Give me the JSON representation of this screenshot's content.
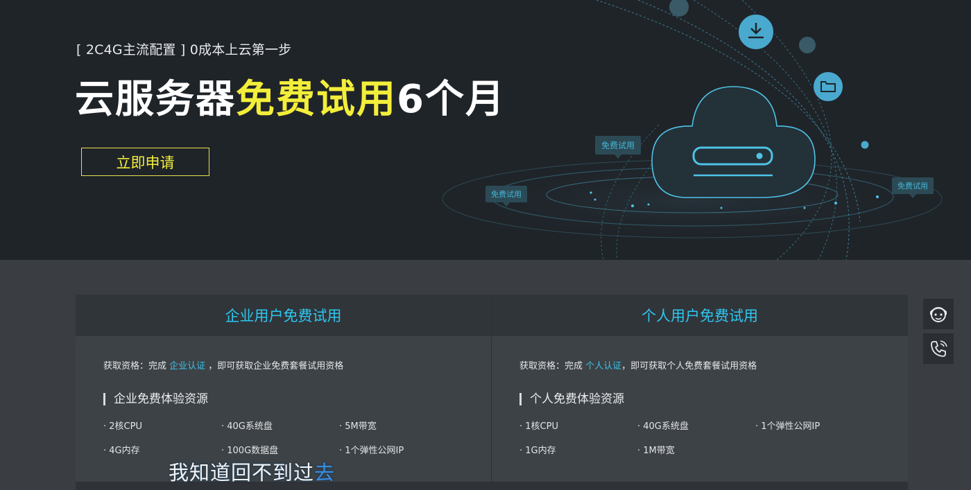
{
  "hero": {
    "subtitle": "[ 2C4G主流配置 ] 0成本上云第一步",
    "headline_prefix": "云服务器",
    "headline_highlight": "免费试用",
    "headline_suffix": "6个月",
    "apply_button": "立即申请",
    "tags": [
      "免费试用",
      "免费试用",
      "免费试用"
    ]
  },
  "enterprise": {
    "title": "企业用户免费试用",
    "eligibility_prefix": "获取资格：完成 ",
    "eligibility_link": "企业认证",
    "eligibility_suffix": " ，即可获取企业免费套餐试用资格",
    "resources_title": "企业免费体验资源",
    "items": [
      "· 2核CPU",
      "· 40G系统盘",
      "· 5M带宽",
      "· 4G内存",
      "· 100G数据盘",
      "· 1个弹性公网IP"
    ]
  },
  "personal": {
    "title": "个人用户免费试用",
    "eligibility_prefix": "获取资格：完成 ",
    "eligibility_link": "个人认证",
    "eligibility_suffix": "，即可获取个人免费套餐试用资格",
    "resources_title": "个人免费体验资源",
    "items": [
      "· 1核CPU",
      "· 40G系统盘",
      "· 1个弹性公网IP",
      "· 1G内存",
      "· 1M带宽"
    ]
  },
  "side_widget": {
    "icons": [
      "customer-service-icon",
      "phone-icon"
    ]
  },
  "caption": {
    "text_main": "我知道回不到过",
    "text_end": "去"
  },
  "colors": {
    "accent_blue": "#2ec7f0",
    "highlight_yellow": "#f3ee3a",
    "hero_bg": "#1f2429"
  }
}
